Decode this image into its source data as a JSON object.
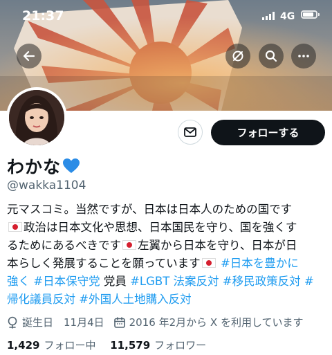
{
  "status_bar": {
    "time": "21:37",
    "network": "4G"
  },
  "profile": {
    "display_name": "わかな",
    "handle": "@wakka1104",
    "follow_label": "フォローする",
    "bio": {
      "line1": "元マスコミ。当然ですが、日本は日本人のための国です",
      "line2": "政治は日本文化や思想、日本国民を守り、国を強くす",
      "line3a": "るためにあるべきです",
      "line3b": "左翼から日本を守り、日本が日",
      "line4a": "本らしく発展することを願っています",
      "line4tag": "#日本を豊かに",
      "line5tag1": "強く",
      "line5tag2": "#日本保守党",
      "line5text": "党員",
      "line5tag3": "#LGBT 法案反対",
      "line5tag4": "#移民政策反対",
      "line5tag5": "#",
      "line6tag1": "帰化議員反対",
      "line6tag2": "#外国人土地購入反対"
    },
    "birthday": "誕生日　11月4日",
    "joined": "2016 年2月から X を利用しています",
    "following_count": "1,429",
    "following_label": "フォロー中",
    "followers_count": "11,579",
    "followers_label": "フォロワー"
  },
  "colors": {
    "accent": "#1d9bf0",
    "follow_button": "#0f1419",
    "heart": "#2b8ce6"
  },
  "icons": [
    "back-arrow-icon",
    "link-off-icon",
    "search-icon",
    "more-icon",
    "mail-icon",
    "location-icon",
    "calendar-icon",
    "blue-heart-icon",
    "japan-flag-icon"
  ]
}
